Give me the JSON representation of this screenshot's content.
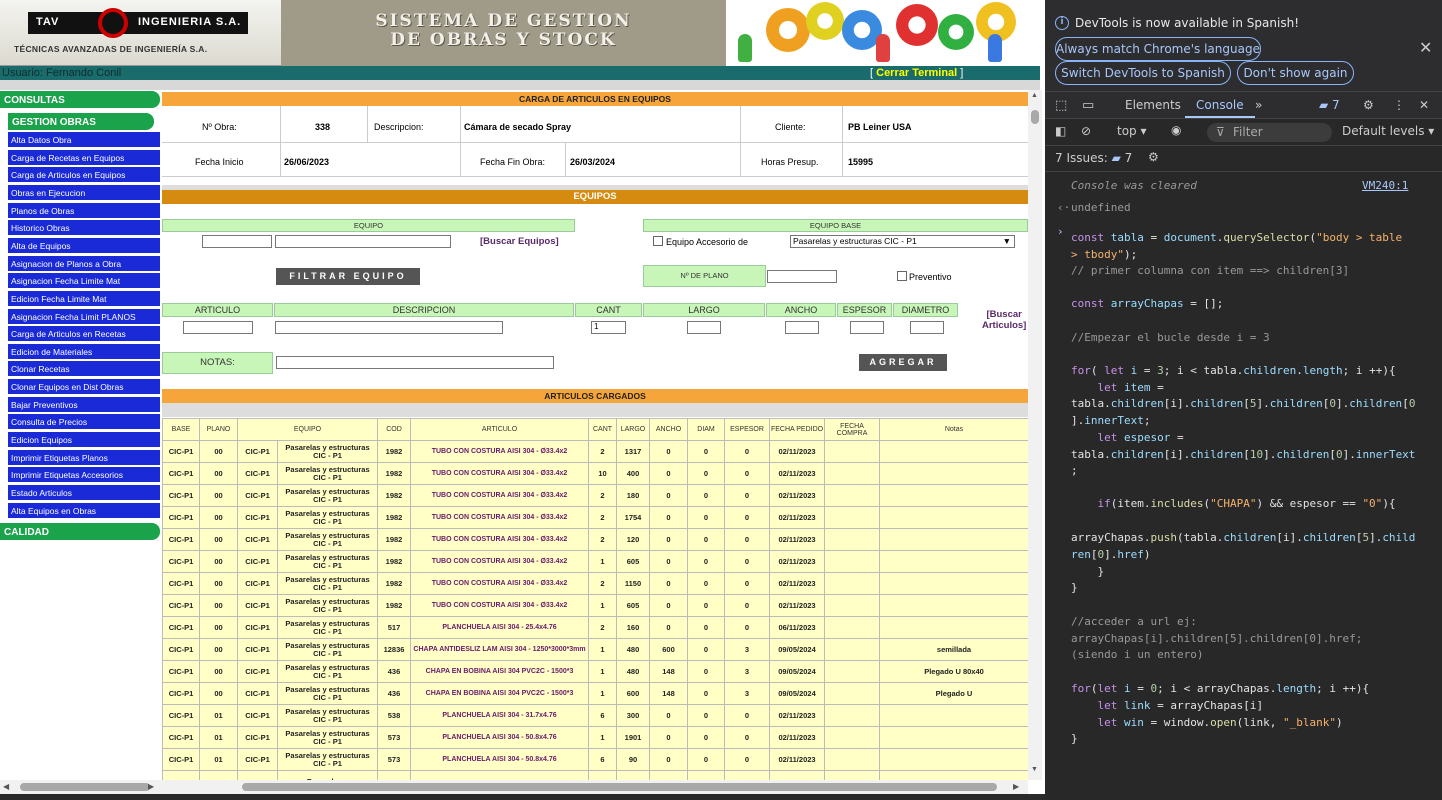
{
  "header": {
    "logo_left": "TAV",
    "logo_right": "INGENIERIA S.A.",
    "logo_sub": "TÉCNICAS AVANZADAS DE INGENIERÍA S.A.",
    "banner_line1": "SISTEMA DE GESTION",
    "banner_line2": "DE OBRAS Y STOCK"
  },
  "userbar": {
    "user": "Usuario: Fernando Conil",
    "logout": "Cerrar Terminal",
    "bracket_open": "[",
    "bracket_close": "]"
  },
  "menu": {
    "consultas": "CONSULTAS",
    "gestion": "GESTION OBRAS",
    "calidad": "CALIDAD",
    "items": [
      "Alta Datos Obra",
      "Carga de Recetas en Equipos",
      "Carga de Articulos en Equipos",
      "Obras en Ejecucion",
      "Planos de Obras",
      "Historico Obras",
      "Alta de Equipos",
      "Asignacion de Planos a Obra",
      "Asignacion Fecha Limite Mat",
      "Edicion Fecha Limite Mat",
      "Asignacion Fecha Limit PLANOS",
      "Carga de Articulos en Recetas",
      "Edicion de Materiales",
      "Clonar Recetas",
      "Clonar Equipos en Dist Obras",
      "Bajar Preventivos",
      "Consulta de Precios",
      "Edicion Equipos",
      "Imprimir Etiquetas Planos",
      "Imprimir Etiquetas Accesorios",
      "Estado Articulos",
      "Alta Equipos en Obras"
    ]
  },
  "carga": {
    "title": "CARGA DE ARTICULOS EN EQUIPOS",
    "obra_label": "Nº Obra:",
    "obra_value": "338",
    "desc_label": "Descripcion:",
    "desc_value": "Cámara de secado Spray",
    "cliente_label": "Cliente:",
    "cliente_value": "PB Leiner USA",
    "inicio_label": "Fecha Inicio",
    "inicio_value": "26/06/2023",
    "fin_label": "Fecha Fin Obra:",
    "fin_value": "26/03/2024",
    "horas_label": "Horas Presup.",
    "horas_value": "15995"
  },
  "equipos": {
    "title": "EQUIPOS",
    "equipo_label": "EQUIPO",
    "equipo_base_label": "EQUIPO BASE",
    "buscar_equipos": "[Buscar Equipos]",
    "accesorio_label": "Equipo Accesorio de",
    "base_select": "Pasarelas y estructuras CIC - P1",
    "filtrar": "FILTRAR EQUIPO",
    "plano_label": "Nº DE PLANO",
    "preventivo": "Preventivo",
    "cols": [
      "ARTICULO",
      "DESCRIPCION",
      "CANT",
      "LARGO",
      "ANCHO",
      "ESPESOR",
      "DIAMETRO"
    ],
    "cant_value": "1",
    "buscar_articulos_1": "[Buscar",
    "buscar_articulos_2": "Articulos]",
    "notas_label": "NOTAS:",
    "agregar": "AGREGAR"
  },
  "cargados": {
    "title": "ARTICULOS CARGADOS",
    "headers": [
      "BASE",
      "PLANO",
      "EQUIPO",
      "COD",
      "ARTICULO",
      "CANT",
      "LARGO",
      "ANCHO",
      "DIAM",
      "ESPESOR",
      "FECHA PEDIDO",
      "FECHA COMPRA",
      "Notas"
    ],
    "rows": [
      [
        "CIC-P1",
        "00",
        "CIC-P1",
        "Pasarelas y estructuras CIC - P1",
        "1982",
        "TUBO CON COSTURA AISI 304 - Ø33.4x2",
        "2",
        "1317",
        "0",
        "0",
        "0",
        "02/11/2023",
        "",
        ""
      ],
      [
        "CIC-P1",
        "00",
        "CIC-P1",
        "Pasarelas y estructuras CIC - P1",
        "1982",
        "TUBO CON COSTURA AISI 304 - Ø33.4x2",
        "10",
        "400",
        "0",
        "0",
        "0",
        "02/11/2023",
        "",
        ""
      ],
      [
        "CIC-P1",
        "00",
        "CIC-P1",
        "Pasarelas y estructuras CIC - P1",
        "1982",
        "TUBO CON COSTURA AISI 304 - Ø33.4x2",
        "2",
        "180",
        "0",
        "0",
        "0",
        "02/11/2023",
        "",
        ""
      ],
      [
        "CIC-P1",
        "00",
        "CIC-P1",
        "Pasarelas y estructuras CIC - P1",
        "1982",
        "TUBO CON COSTURA AISI 304 - Ø33.4x2",
        "2",
        "1754",
        "0",
        "0",
        "0",
        "02/11/2023",
        "",
        ""
      ],
      [
        "CIC-P1",
        "00",
        "CIC-P1",
        "Pasarelas y estructuras CIC - P1",
        "1982",
        "TUBO CON COSTURA AISI 304 - Ø33.4x2",
        "2",
        "120",
        "0",
        "0",
        "0",
        "02/11/2023",
        "",
        ""
      ],
      [
        "CIC-P1",
        "00",
        "CIC-P1",
        "Pasarelas y estructuras CIC - P1",
        "1982",
        "TUBO CON COSTURA AISI 304 - Ø33.4x2",
        "1",
        "605",
        "0",
        "0",
        "0",
        "02/11/2023",
        "",
        ""
      ],
      [
        "CIC-P1",
        "00",
        "CIC-P1",
        "Pasarelas y estructuras CIC - P1",
        "1982",
        "TUBO CON COSTURA AISI 304 - Ø33.4x2",
        "2",
        "1150",
        "0",
        "0",
        "0",
        "02/11/2023",
        "",
        ""
      ],
      [
        "CIC-P1",
        "00",
        "CIC-P1",
        "Pasarelas y estructuras CIC - P1",
        "1982",
        "TUBO CON COSTURA AISI 304 - Ø33.4x2",
        "1",
        "605",
        "0",
        "0",
        "0",
        "02/11/2023",
        "",
        ""
      ],
      [
        "CIC-P1",
        "00",
        "CIC-P1",
        "Pasarelas y estructuras CIC - P1",
        "517",
        "PLANCHUELA AISI 304 - 25.4x4.76",
        "2",
        "160",
        "0",
        "0",
        "0",
        "06/11/2023",
        "",
        ""
      ],
      [
        "CIC-P1",
        "00",
        "CIC-P1",
        "Pasarelas y estructuras CIC - P1",
        "12836",
        "CHAPA ANTIDESLIZ LAM AISI 304 - 1250*3000*3mm",
        "1",
        "480",
        "600",
        "0",
        "3",
        "09/05/2024",
        "",
        "semillada"
      ],
      [
        "CIC-P1",
        "00",
        "CIC-P1",
        "Pasarelas y estructuras CIC - P1",
        "436",
        "CHAPA EN BOBINA AISI 304 PVC2C - 1500*3",
        "1",
        "480",
        "148",
        "0",
        "3",
        "09/05/2024",
        "",
        "Plegado U 80x40"
      ],
      [
        "CIC-P1",
        "00",
        "CIC-P1",
        "Pasarelas y estructuras CIC - P1",
        "436",
        "CHAPA EN BOBINA AISI 304 PVC2C - 1500*3",
        "1",
        "600",
        "148",
        "0",
        "3",
        "09/05/2024",
        "",
        "Plegado U"
      ],
      [
        "CIC-P1",
        "01",
        "CIC-P1",
        "Pasarelas y estructuras CIC - P1",
        "538",
        "PLANCHUELA AISI 304 - 31.7x4.76",
        "6",
        "300",
        "0",
        "0",
        "0",
        "02/11/2023",
        "",
        ""
      ],
      [
        "CIC-P1",
        "01",
        "CIC-P1",
        "Pasarelas y estructuras CIC - P1",
        "573",
        "PLANCHUELA AISI 304 - 50.8x4.76",
        "1",
        "1901",
        "0",
        "0",
        "0",
        "02/11/2023",
        "",
        ""
      ],
      [
        "CIC-P1",
        "01",
        "CIC-P1",
        "Pasarelas y estructuras CIC - P1",
        "573",
        "PLANCHUELA AISI 304 - 50.8x4.76",
        "6",
        "90",
        "0",
        "0",
        "0",
        "02/11/2023",
        "",
        ""
      ],
      [
        "",
        "",
        "",
        "Pasarelas y",
        "",
        "",
        "",
        "",
        "",
        "",
        "",
        "",
        "",
        ""
      ]
    ]
  },
  "devtools": {
    "info": "DevTools is now available in Spanish!",
    "btn1": "Always match Chrome's language",
    "btn2": "Switch DevTools to Spanish",
    "btn3": "Don't show again",
    "tab_elements": "Elements",
    "tab_console": "Console",
    "issues_badge": "7",
    "context": "top",
    "filter": "Filter",
    "levels": "Default levels",
    "issues_text": "7 Issues:",
    "issues_count": "7",
    "cleared": "Console was cleared",
    "vm": "VM240:1",
    "undefined": "undefined"
  }
}
